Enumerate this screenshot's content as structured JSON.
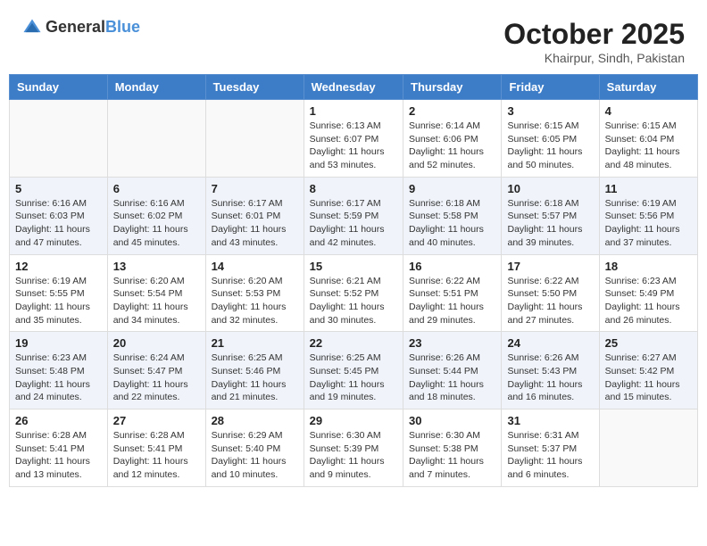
{
  "header": {
    "logo_general": "General",
    "logo_blue": "Blue",
    "month": "October 2025",
    "location": "Khairpur, Sindh, Pakistan"
  },
  "weekdays": [
    "Sunday",
    "Monday",
    "Tuesday",
    "Wednesday",
    "Thursday",
    "Friday",
    "Saturday"
  ],
  "weeks": [
    [
      {
        "day": "",
        "sunrise": "",
        "sunset": "",
        "daylight": ""
      },
      {
        "day": "",
        "sunrise": "",
        "sunset": "",
        "daylight": ""
      },
      {
        "day": "",
        "sunrise": "",
        "sunset": "",
        "daylight": ""
      },
      {
        "day": "1",
        "sunrise": "Sunrise: 6:13 AM",
        "sunset": "Sunset: 6:07 PM",
        "daylight": "Daylight: 11 hours and 53 minutes."
      },
      {
        "day": "2",
        "sunrise": "Sunrise: 6:14 AM",
        "sunset": "Sunset: 6:06 PM",
        "daylight": "Daylight: 11 hours and 52 minutes."
      },
      {
        "day": "3",
        "sunrise": "Sunrise: 6:15 AM",
        "sunset": "Sunset: 6:05 PM",
        "daylight": "Daylight: 11 hours and 50 minutes."
      },
      {
        "day": "4",
        "sunrise": "Sunrise: 6:15 AM",
        "sunset": "Sunset: 6:04 PM",
        "daylight": "Daylight: 11 hours and 48 minutes."
      }
    ],
    [
      {
        "day": "5",
        "sunrise": "Sunrise: 6:16 AM",
        "sunset": "Sunset: 6:03 PM",
        "daylight": "Daylight: 11 hours and 47 minutes."
      },
      {
        "day": "6",
        "sunrise": "Sunrise: 6:16 AM",
        "sunset": "Sunset: 6:02 PM",
        "daylight": "Daylight: 11 hours and 45 minutes."
      },
      {
        "day": "7",
        "sunrise": "Sunrise: 6:17 AM",
        "sunset": "Sunset: 6:01 PM",
        "daylight": "Daylight: 11 hours and 43 minutes."
      },
      {
        "day": "8",
        "sunrise": "Sunrise: 6:17 AM",
        "sunset": "Sunset: 5:59 PM",
        "daylight": "Daylight: 11 hours and 42 minutes."
      },
      {
        "day": "9",
        "sunrise": "Sunrise: 6:18 AM",
        "sunset": "Sunset: 5:58 PM",
        "daylight": "Daylight: 11 hours and 40 minutes."
      },
      {
        "day": "10",
        "sunrise": "Sunrise: 6:18 AM",
        "sunset": "Sunset: 5:57 PM",
        "daylight": "Daylight: 11 hours and 39 minutes."
      },
      {
        "day": "11",
        "sunrise": "Sunrise: 6:19 AM",
        "sunset": "Sunset: 5:56 PM",
        "daylight": "Daylight: 11 hours and 37 minutes."
      }
    ],
    [
      {
        "day": "12",
        "sunrise": "Sunrise: 6:19 AM",
        "sunset": "Sunset: 5:55 PM",
        "daylight": "Daylight: 11 hours and 35 minutes."
      },
      {
        "day": "13",
        "sunrise": "Sunrise: 6:20 AM",
        "sunset": "Sunset: 5:54 PM",
        "daylight": "Daylight: 11 hours and 34 minutes."
      },
      {
        "day": "14",
        "sunrise": "Sunrise: 6:20 AM",
        "sunset": "Sunset: 5:53 PM",
        "daylight": "Daylight: 11 hours and 32 minutes."
      },
      {
        "day": "15",
        "sunrise": "Sunrise: 6:21 AM",
        "sunset": "Sunset: 5:52 PM",
        "daylight": "Daylight: 11 hours and 30 minutes."
      },
      {
        "day": "16",
        "sunrise": "Sunrise: 6:22 AM",
        "sunset": "Sunset: 5:51 PM",
        "daylight": "Daylight: 11 hours and 29 minutes."
      },
      {
        "day": "17",
        "sunrise": "Sunrise: 6:22 AM",
        "sunset": "Sunset: 5:50 PM",
        "daylight": "Daylight: 11 hours and 27 minutes."
      },
      {
        "day": "18",
        "sunrise": "Sunrise: 6:23 AM",
        "sunset": "Sunset: 5:49 PM",
        "daylight": "Daylight: 11 hours and 26 minutes."
      }
    ],
    [
      {
        "day": "19",
        "sunrise": "Sunrise: 6:23 AM",
        "sunset": "Sunset: 5:48 PM",
        "daylight": "Daylight: 11 hours and 24 minutes."
      },
      {
        "day": "20",
        "sunrise": "Sunrise: 6:24 AM",
        "sunset": "Sunset: 5:47 PM",
        "daylight": "Daylight: 11 hours and 22 minutes."
      },
      {
        "day": "21",
        "sunrise": "Sunrise: 6:25 AM",
        "sunset": "Sunset: 5:46 PM",
        "daylight": "Daylight: 11 hours and 21 minutes."
      },
      {
        "day": "22",
        "sunrise": "Sunrise: 6:25 AM",
        "sunset": "Sunset: 5:45 PM",
        "daylight": "Daylight: 11 hours and 19 minutes."
      },
      {
        "day": "23",
        "sunrise": "Sunrise: 6:26 AM",
        "sunset": "Sunset: 5:44 PM",
        "daylight": "Daylight: 11 hours and 18 minutes."
      },
      {
        "day": "24",
        "sunrise": "Sunrise: 6:26 AM",
        "sunset": "Sunset: 5:43 PM",
        "daylight": "Daylight: 11 hours and 16 minutes."
      },
      {
        "day": "25",
        "sunrise": "Sunrise: 6:27 AM",
        "sunset": "Sunset: 5:42 PM",
        "daylight": "Daylight: 11 hours and 15 minutes."
      }
    ],
    [
      {
        "day": "26",
        "sunrise": "Sunrise: 6:28 AM",
        "sunset": "Sunset: 5:41 PM",
        "daylight": "Daylight: 11 hours and 13 minutes."
      },
      {
        "day": "27",
        "sunrise": "Sunrise: 6:28 AM",
        "sunset": "Sunset: 5:41 PM",
        "daylight": "Daylight: 11 hours and 12 minutes."
      },
      {
        "day": "28",
        "sunrise": "Sunrise: 6:29 AM",
        "sunset": "Sunset: 5:40 PM",
        "daylight": "Daylight: 11 hours and 10 minutes."
      },
      {
        "day": "29",
        "sunrise": "Sunrise: 6:30 AM",
        "sunset": "Sunset: 5:39 PM",
        "daylight": "Daylight: 11 hours and 9 minutes."
      },
      {
        "day": "30",
        "sunrise": "Sunrise: 6:30 AM",
        "sunset": "Sunset: 5:38 PM",
        "daylight": "Daylight: 11 hours and 7 minutes."
      },
      {
        "day": "31",
        "sunrise": "Sunrise: 6:31 AM",
        "sunset": "Sunset: 5:37 PM",
        "daylight": "Daylight: 11 hours and 6 minutes."
      },
      {
        "day": "",
        "sunrise": "",
        "sunset": "",
        "daylight": ""
      }
    ]
  ]
}
